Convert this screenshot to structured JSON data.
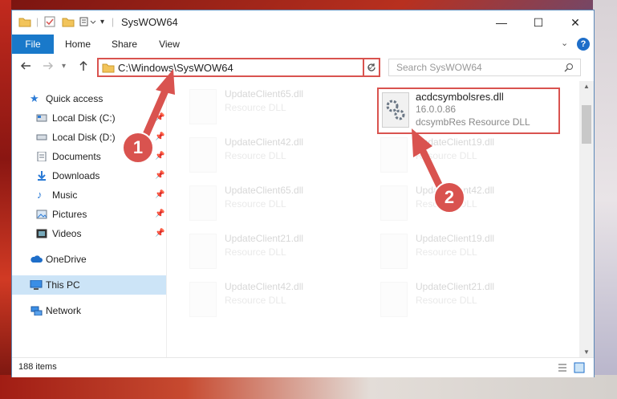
{
  "window": {
    "title": "SysWOW64",
    "controls": {
      "minimize": "—",
      "maximize": "☐",
      "close": "✕"
    }
  },
  "ribbon": {
    "tabs": [
      "File",
      "Home",
      "Share",
      "View"
    ]
  },
  "address": {
    "path": "C:\\Windows\\SysWOW64",
    "search_placeholder": "Search SysWOW64"
  },
  "sidebar": {
    "items": [
      {
        "label": "Quick access"
      },
      {
        "label": "Local Disk (C:)"
      },
      {
        "label": "Local Disk (D:)"
      },
      {
        "label": "Documents"
      },
      {
        "label": "Downloads"
      },
      {
        "label": "Music"
      },
      {
        "label": "Pictures"
      },
      {
        "label": "Videos"
      },
      {
        "label": "OneDrive"
      },
      {
        "label": "This PC"
      },
      {
        "label": "Network"
      }
    ]
  },
  "files": {
    "left": [
      {
        "name": "UpdateClient65.dll",
        "sub": "Resource DLL"
      },
      {
        "name": "UpdateClient42.dll",
        "sub": "Resource DLL"
      },
      {
        "name": "UpdateClient65.dll",
        "sub": "Resource DLL"
      },
      {
        "name": "UpdateClient21.dll",
        "sub": "Resource DLL"
      },
      {
        "name": "UpdateClient42.dll",
        "sub": "Resource DLL"
      }
    ],
    "right": [
      {
        "name": "acdcsymbolsres.dll",
        "version": "16.0.0.86",
        "sub": "dcsymbRes Resource DLL"
      },
      {
        "name": "UpdateClient19.dll",
        "sub": "Resource DLL"
      },
      {
        "name": "UpdateClient42.dll",
        "sub": "Resource DLL"
      },
      {
        "name": "UpdateClient19.dll",
        "sub": "Resource DLL"
      },
      {
        "name": "UpdateClient21.dll",
        "sub": "Resource DLL"
      }
    ]
  },
  "status": {
    "items": "188 items"
  },
  "callouts": {
    "one": "1",
    "two": "2"
  },
  "colors": {
    "accent": "#1979ca",
    "highlight": "#d9534f"
  }
}
